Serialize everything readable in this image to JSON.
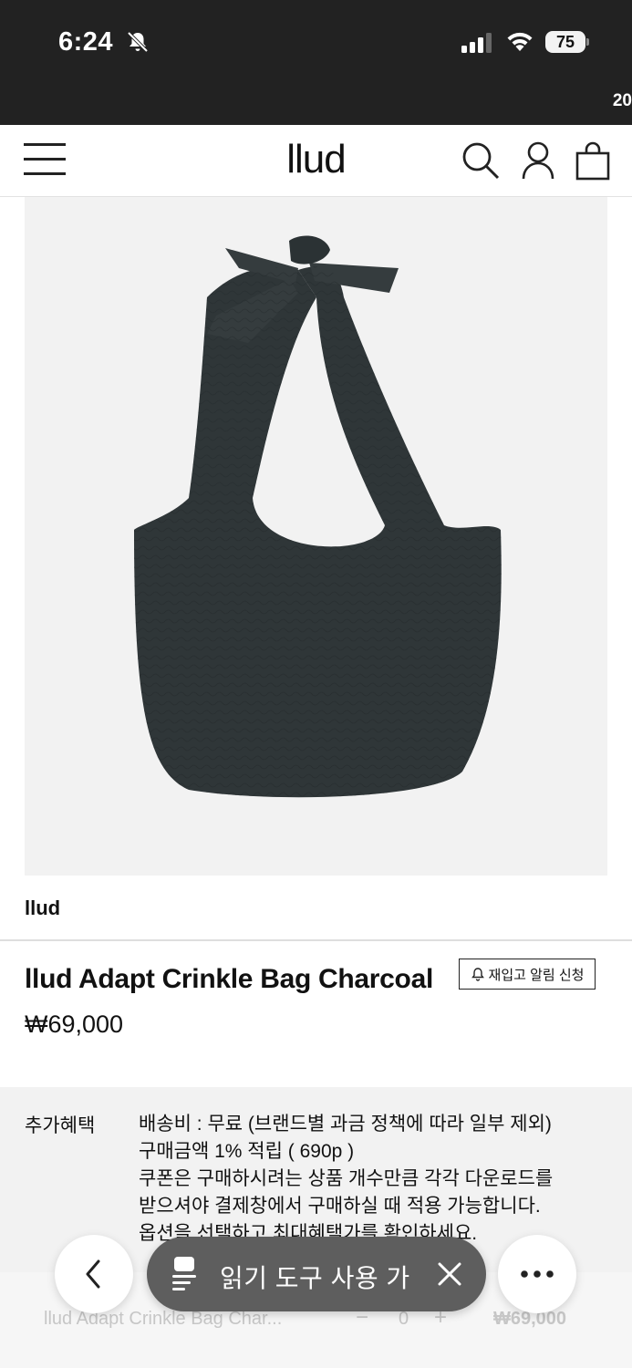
{
  "status_bar": {
    "time": "6:24",
    "battery_level": "75",
    "overflow_text": "20"
  },
  "header": {
    "logo": "llud"
  },
  "product": {
    "brand": "llud",
    "title": "llud Adapt Crinkle Bag Charcoal",
    "restock_label": "재입고 알림 신청",
    "price": "₩69,000",
    "image_color": "#2f3638"
  },
  "benefits": {
    "label": "추가혜택",
    "lines": [
      "배송비 : 무료 (브랜드별 과금 정책에 따라 일부 제외)",
      "구매금액 1% 적립 ( 690p )",
      "쿠폰은 구매하시려는 상품 개수만큼 각각 다운로드를",
      "받으셔야 결제창에서 구매하실 때 적용 가능합니다.",
      "옵션을 선택하고 최대혜택가를 확인하세요."
    ]
  },
  "buy_bar": {
    "name": "llud Adapt Crinkle Bag Char...",
    "minus": "−",
    "quantity": "0",
    "plus": "+",
    "price": "₩69,000"
  },
  "browser_controls": {
    "reader_text": "읽기 도구 사용 가능",
    "icons": [
      "back-icon",
      "reader-mode-icon",
      "close-icon",
      "more-icon"
    ]
  }
}
